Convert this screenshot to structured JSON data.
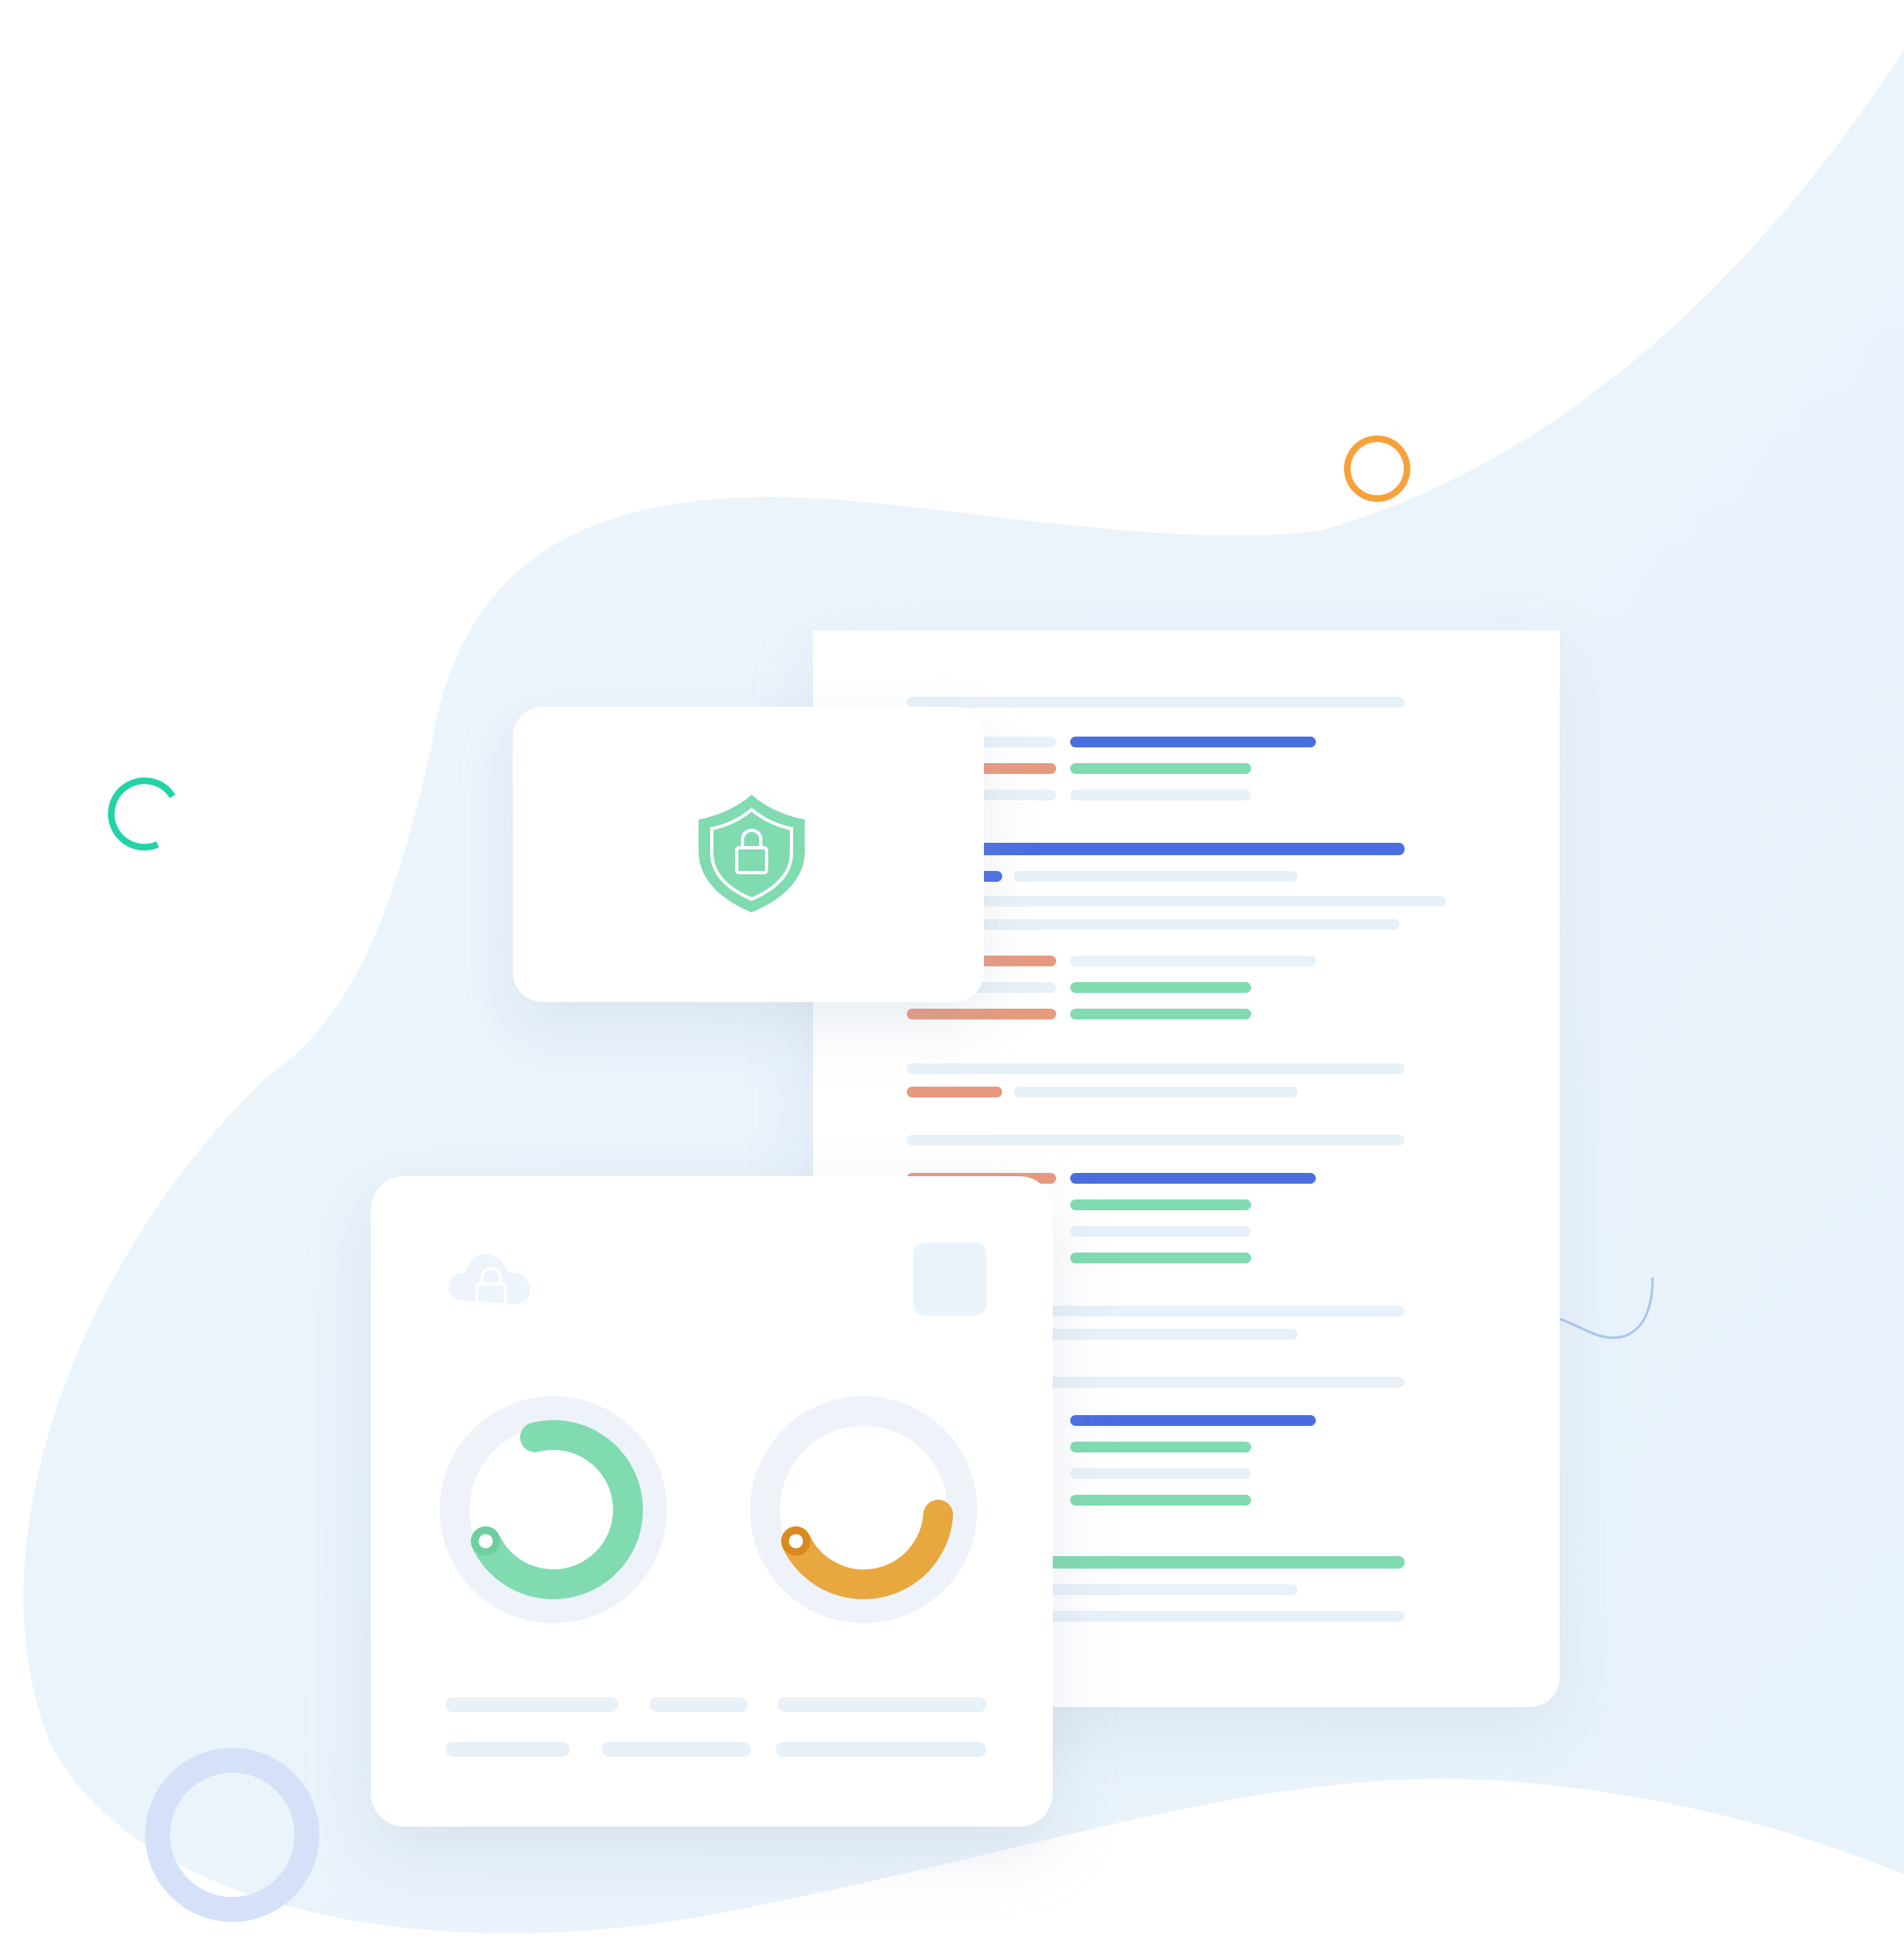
{
  "illustration": {
    "icons": {
      "shield": "shield-lock-icon",
      "cloud": "cloud-lock-icon"
    },
    "colors": {
      "blob": "#ecf5fc",
      "card": "#ffffff",
      "placeholder": "#e9f1f8",
      "blue": "#4a6ee0",
      "green": "#80dbb0",
      "salmon": "#e79a7e",
      "orange": "#e8a83f",
      "ring_orange": "#f7a13b",
      "ring_teal": "#22d3a5",
      "ring_lightblue": "#d4e1f9"
    },
    "gauges": [
      {
        "name": "green-gauge",
        "color": "#80dbb0",
        "fraction": 0.72
      },
      {
        "name": "orange-gauge",
        "color": "#e8a83f",
        "fraction": 0.42
      }
    ]
  }
}
